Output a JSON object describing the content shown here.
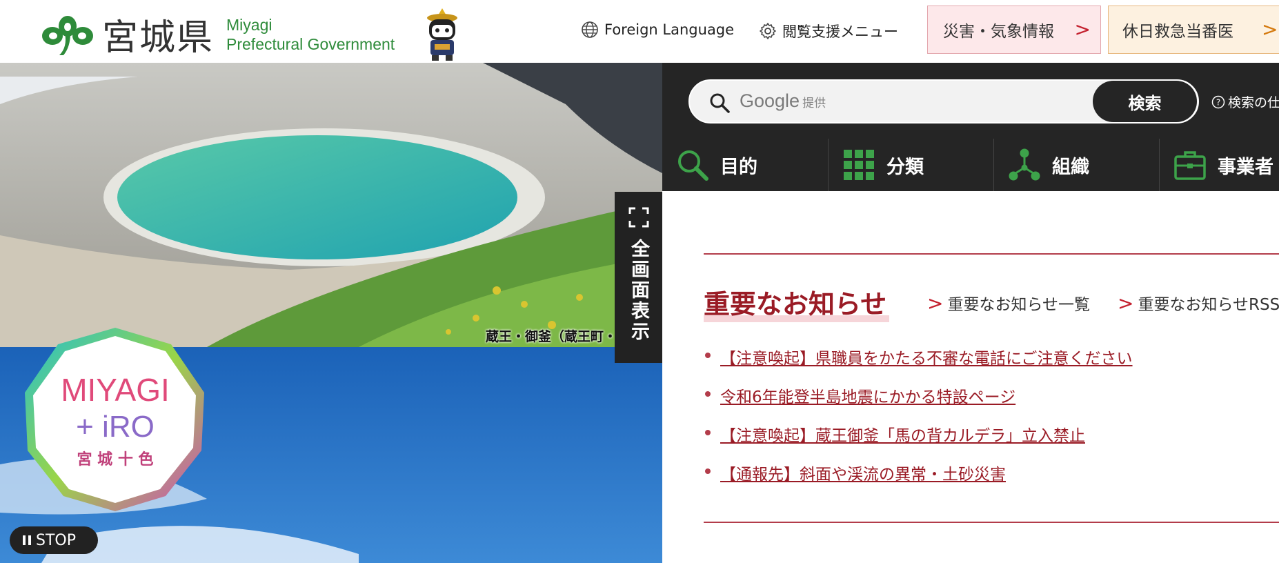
{
  "header": {
    "logo_kanji": "宮城県",
    "logo_en_line1": "Miyagi",
    "logo_en_line2": "Prefectural Government",
    "foreign_language": "Foreign Language",
    "accessibility_menu": "閲覧支援メニュー",
    "disaster_button": "災害・気象情報",
    "holiday_doctor_button": "休日救急当番医",
    "chevron": ">"
  },
  "hero": {
    "caption": "蔵王・御釜（蔵王町・川",
    "fullscreen_label": "全画面表示",
    "badge_line1": "MIYAGI",
    "badge_line2": "+ iRO",
    "badge_line3": "宮 城 十 色",
    "stop_label": "STOP"
  },
  "search": {
    "placeholder_brand": "Google",
    "placeholder_suffix": "提供",
    "submit_label": "検索",
    "help_label": "検索の仕"
  },
  "nav": {
    "items": [
      {
        "label": "目的",
        "icon": "magnifier-icon"
      },
      {
        "label": "分類",
        "icon": "grid-icon"
      },
      {
        "label": "組織",
        "icon": "org-chart-icon"
      },
      {
        "label": "事業者",
        "icon": "briefcase-icon"
      }
    ]
  },
  "news": {
    "title": "重要なお知らせ",
    "list_link": "重要なお知らせ一覧",
    "rss_link": "重要なお知らせRSS",
    "items": [
      "【注意喚起】県職員をかたる不審な電話にご注意ください",
      "令和6年能登半島地震にかかる特設ページ",
      "【注意喚起】蔵王御釜「馬の背カルデラ」立入禁止",
      "【通報先】斜面や渓流の異常・土砂災害"
    ]
  },
  "colors": {
    "brand_green": "#2e8b3a",
    "news_red": "#9a1b25",
    "dark_panel": "#252525",
    "nav_icon_green": "#3da34a"
  }
}
